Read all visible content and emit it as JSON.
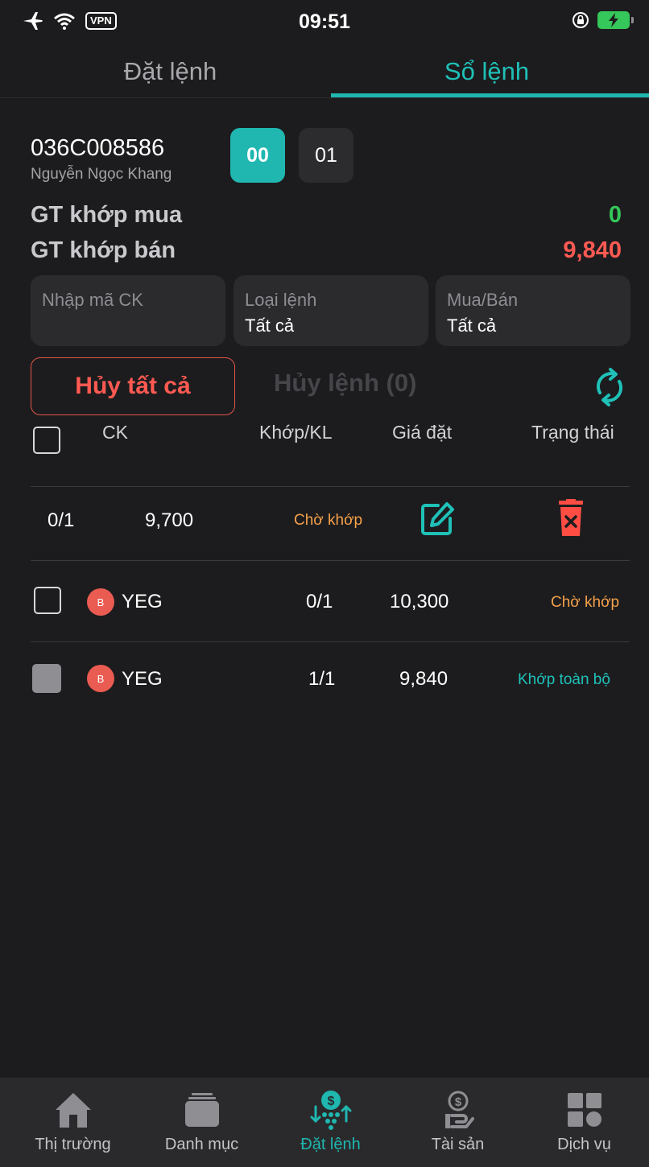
{
  "status_bar": {
    "time": "09:51",
    "vpn": "VPN"
  },
  "tabs": [
    {
      "label": "Đặt lệnh",
      "active": false
    },
    {
      "label": "Sổ lệnh",
      "active": true
    }
  ],
  "account": {
    "number": "036C008586",
    "holder": "Nguyễn Ngọc Khang",
    "sub_accounts": [
      "00",
      "01"
    ],
    "selected_sub": "00"
  },
  "summary": {
    "buy_label": "GT khớp mua",
    "buy_value": "0",
    "sell_label": "GT khớp bán",
    "sell_value": "9,840"
  },
  "filters": {
    "symbol_placeholder": "Nhập mã CK",
    "order_type_label": "Loại lệnh",
    "order_type_value": "Tất cả",
    "side_label": "Mua/Bán",
    "side_value": "Tất cả"
  },
  "actions": {
    "cancel_all": "Hủy tất cả",
    "cancel_selected": "Hủy lệnh (0)"
  },
  "table": {
    "headers": [
      "CK",
      "Khớp/KL",
      "Giá đặt",
      "Trạng thái"
    ],
    "expanded_row": {
      "match_qty": "0/1",
      "price": "9,700",
      "status": "Chờ khớp"
    },
    "rows": [
      {
        "side": "B",
        "symbol": "YEG",
        "match_qty": "0/1",
        "price": "10,300",
        "status": "Chờ khớp"
      },
      {
        "side": "B",
        "symbol": "YEG",
        "match_qty": "1/1",
        "price": "9,840",
        "status": "Khớp toàn bộ"
      }
    ]
  },
  "colors": {
    "accent": "#1fb7b0",
    "buy_green": "#35c759",
    "sell_red": "#ff5a52",
    "pending_orange": "#f5a14a",
    "background": "#1c1c1e"
  },
  "bottom_nav": [
    {
      "label": "Thị trường",
      "icon": "home-icon"
    },
    {
      "label": "Danh mục",
      "icon": "folder-icon"
    },
    {
      "label": "Đặt lệnh",
      "icon": "order-icon",
      "active": true
    },
    {
      "label": "Tài sản",
      "icon": "asset-icon"
    },
    {
      "label": "Dịch vụ",
      "icon": "services-icon"
    }
  ]
}
